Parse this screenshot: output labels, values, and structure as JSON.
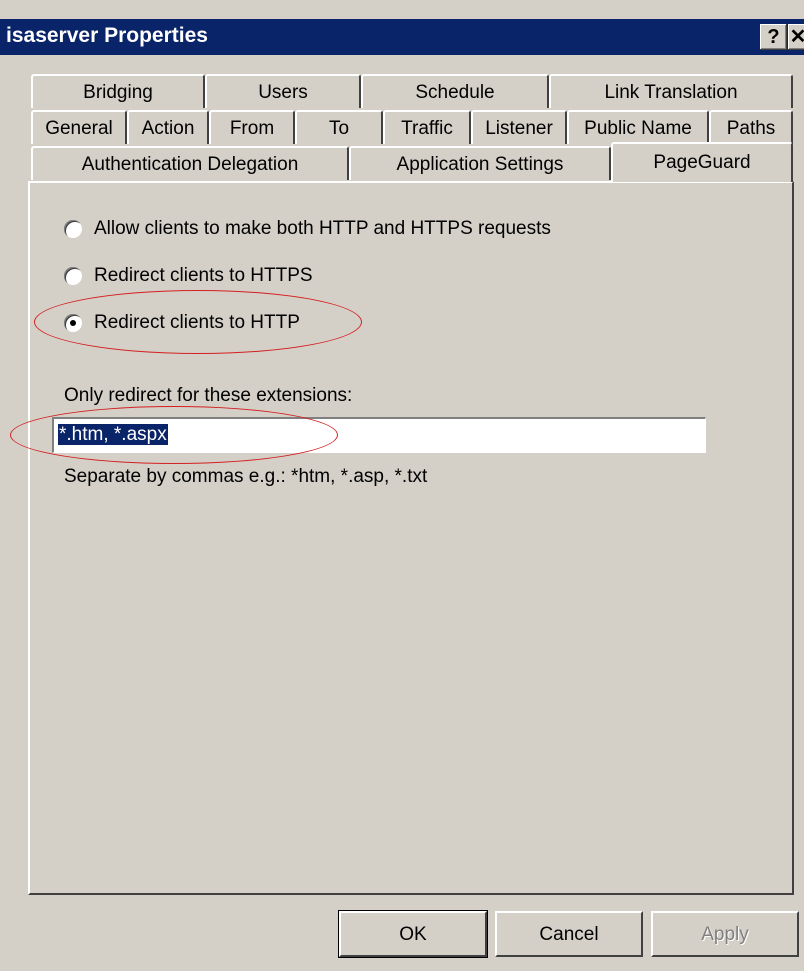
{
  "window": {
    "title": "isaserver Properties",
    "help_label": "?",
    "close_label": "✕"
  },
  "tabs": {
    "row1": [
      "Bridging",
      "Users",
      "Schedule",
      "Link Translation"
    ],
    "row2": [
      "General",
      "Action",
      "From",
      "To",
      "Traffic",
      "Listener",
      "Public Name",
      "Paths"
    ],
    "row3": [
      "Authentication Delegation",
      "Application Settings",
      "PageGuard"
    ],
    "active": "PageGuard"
  },
  "options": [
    {
      "label": "Allow clients to make both HTTP and HTTPS requests",
      "checked": false
    },
    {
      "label": "Redirect clients to HTTPS",
      "checked": false
    },
    {
      "label": "Redirect clients to HTTP",
      "checked": true
    }
  ],
  "extensions": {
    "label": "Only redirect for these extensions:",
    "value": "*.htm, *.aspx",
    "hint": "Separate by commas e.g.: *htm, *.asp, *.txt"
  },
  "buttons": {
    "ok": "OK",
    "cancel": "Cancel",
    "apply": "Apply"
  },
  "colors": {
    "title_bar": "#0a246a",
    "face": "#d4d0c8",
    "annotation": "#d42020"
  }
}
